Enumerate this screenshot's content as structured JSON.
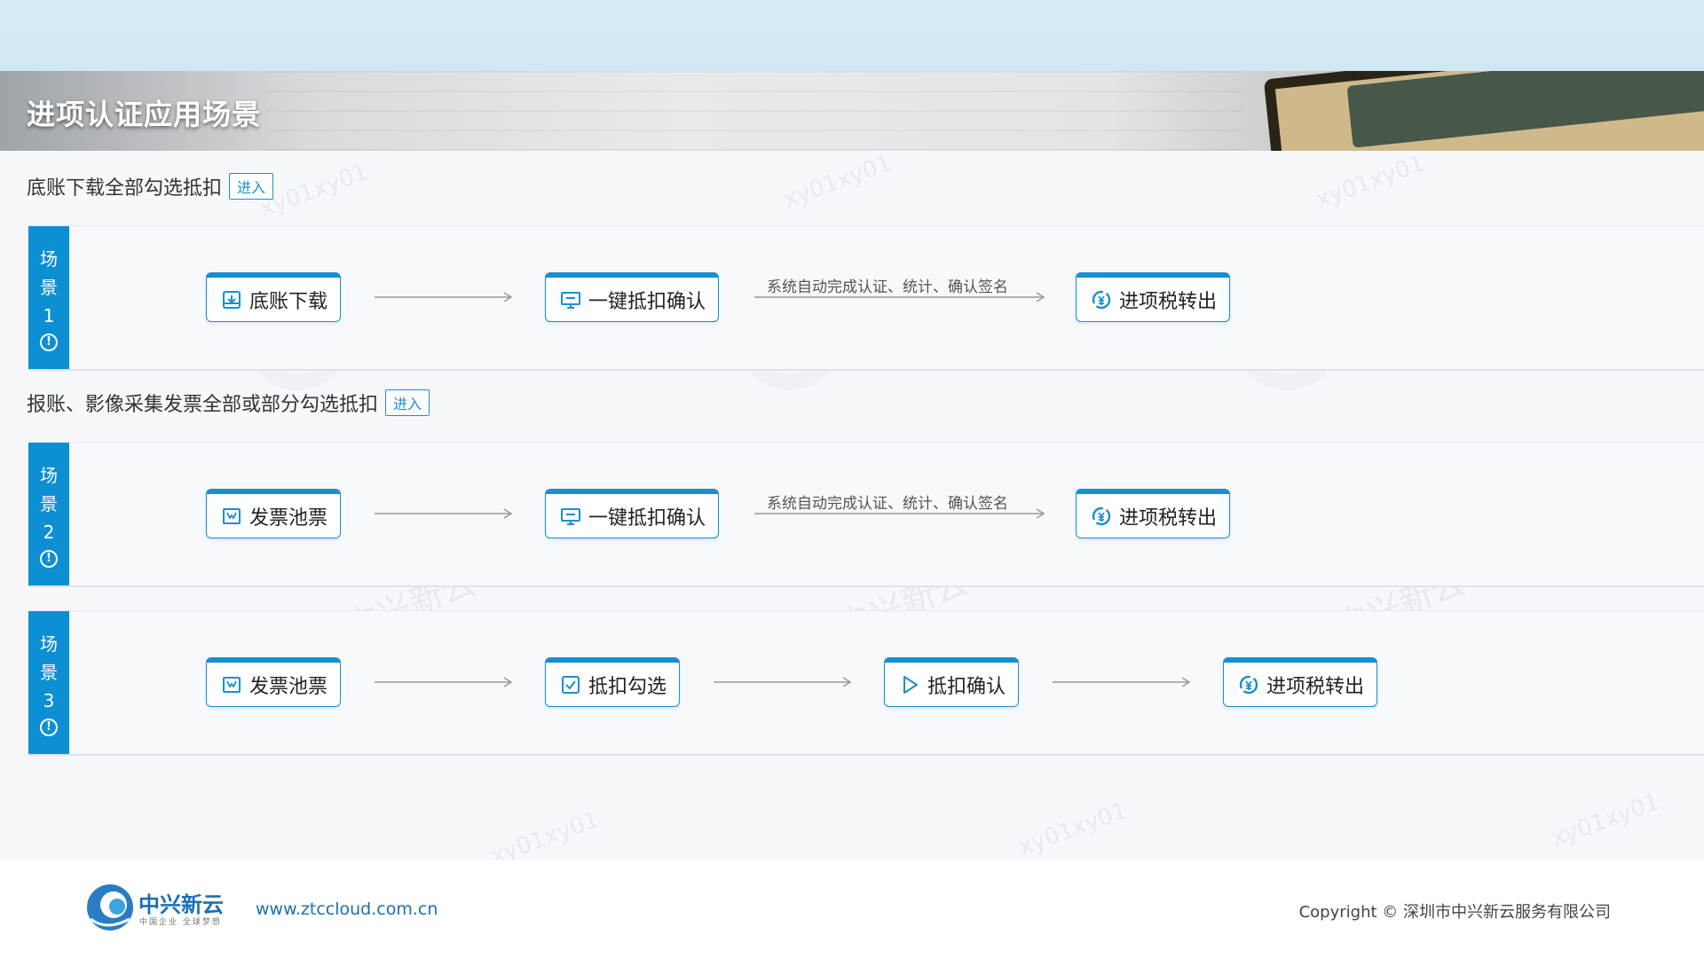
{
  "banner": {
    "title": "进项认证应用场景"
  },
  "sections": [
    {
      "title": "底账下载全部勾选抵扣",
      "enter_label": "进入"
    },
    {
      "title": "报账、影像采集发票全部或部分勾选抵扣",
      "enter_label": "进入"
    }
  ],
  "scenarios": [
    {
      "tag_chars": [
        "场",
        "景",
        "1"
      ],
      "nodes": [
        {
          "label": "底账下载",
          "icon": "download-box-icon"
        },
        {
          "label": "一键抵扣确认",
          "icon": "monitor-icon"
        },
        {
          "label": "进项税转出",
          "icon": "yen-cycle-icon"
        }
      ],
      "arrow_captions": [
        "",
        "系统自动完成认证、统计、确认签名"
      ]
    },
    {
      "tag_chars": [
        "场",
        "景",
        "2"
      ],
      "nodes": [
        {
          "label": "发票池票",
          "icon": "invoice-pool-icon"
        },
        {
          "label": "一键抵扣确认",
          "icon": "monitor-icon"
        },
        {
          "label": "进项税转出",
          "icon": "yen-cycle-icon"
        }
      ],
      "arrow_captions": [
        "",
        "系统自动完成认证、统计、确认签名"
      ]
    },
    {
      "tag_chars": [
        "场",
        "景",
        "3"
      ],
      "nodes": [
        {
          "label": "发票池票",
          "icon": "invoice-pool-icon"
        },
        {
          "label": "抵扣勾选",
          "icon": "checkbox-icon"
        },
        {
          "label": "抵扣确认",
          "icon": "play-icon"
        },
        {
          "label": "进项税转出",
          "icon": "yen-cycle-icon"
        }
      ],
      "arrow_captions": [
        "",
        "",
        ""
      ]
    }
  ],
  "watermark_text": "xy01xy01",
  "watermark_brand": "中兴新云",
  "footer": {
    "brand": "中兴新云",
    "slogan": "中国企业 全球梦想",
    "url": "www.ztccloud.com.cn",
    "copyright": "Copyright © 深圳市中兴新云服务有限公司"
  },
  "colors": {
    "accent": "#1a8fd0",
    "tag_bg": "#0c8fd3",
    "brand": "#1a6fb5"
  }
}
